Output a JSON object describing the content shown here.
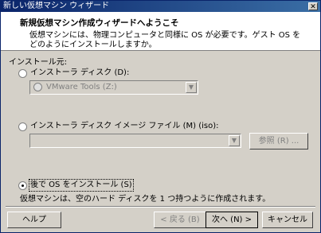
{
  "window": {
    "title": "新しい仮想マシン ウィザード",
    "close": "✕"
  },
  "header": {
    "title": "新規仮想マシン作成ウィザードへようこそ",
    "description": "仮想マシンには、物理コンピュータと同様に OS が必要です。ゲスト OS をどのようにインストールしますか。"
  },
  "install_source": {
    "label": "インストール元:",
    "option_disc": {
      "label": "インストーラ ディスク (D):",
      "selected": false
    },
    "disc_select": {
      "value": "VMware Tools (Z:)",
      "enabled": false
    },
    "option_iso": {
      "label": "インストーラ ディスク イメージ ファイル (M) (iso):",
      "selected": false
    },
    "iso_select": {
      "value": "",
      "enabled": false
    },
    "browse_button": "参照 (R) ...",
    "option_later": {
      "label": "後で OS をインストール (S)",
      "selected": true
    },
    "later_note": "仮想マシンは、空のハード ディスクを 1 つ持つように作成されます。"
  },
  "footer": {
    "help": "ヘルプ",
    "back": "< 戻る (B)",
    "next": "次へ (N) >",
    "cancel": "キャンセル"
  }
}
